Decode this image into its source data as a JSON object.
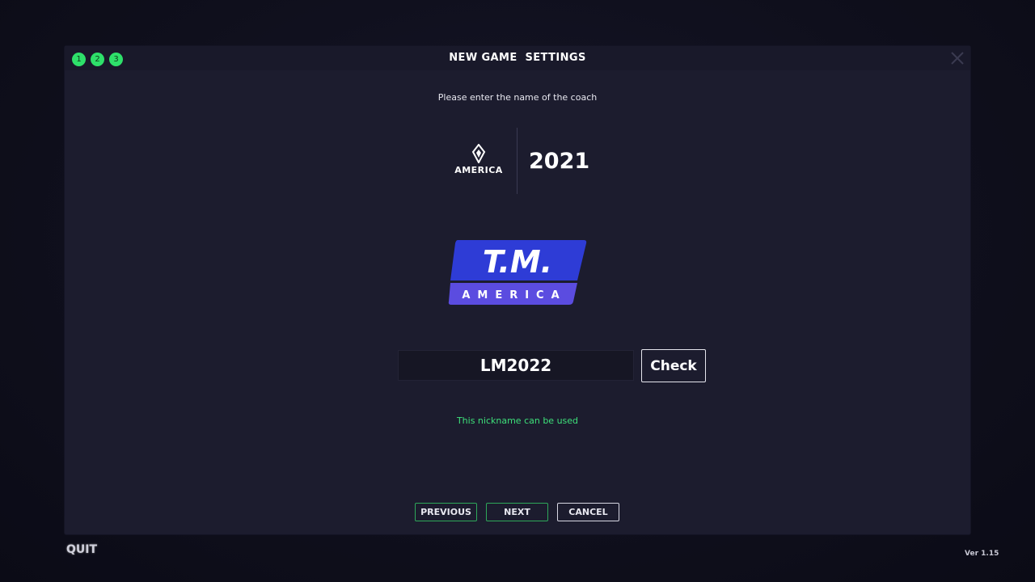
{
  "dialog": {
    "title": "NEW GAME  SETTINGS",
    "steps": [
      "1",
      "2",
      "3"
    ],
    "prompt": "Please enter the name of the coach"
  },
  "league": {
    "name": "AMERICA",
    "season": "2021"
  },
  "team_logo": {
    "line1": "T.M.",
    "line2": "AMERICA",
    "colors": {
      "top": "#2e3cd6",
      "bottom": "#5b4ce0"
    }
  },
  "nickname": {
    "value": "LM2022",
    "check_label": "Check",
    "status": "This nickname can be used",
    "status_color": "#3ee07a"
  },
  "footer": {
    "previous_label": "PREVIOUS",
    "next_label": "NEXT",
    "cancel_label": "CANCEL"
  },
  "quit_label": "QUIT",
  "version": "Ver 1.15",
  "colors": {
    "background": "#0f0f1c",
    "panel": "#1c1c2e",
    "accent_green": "#2ee06a"
  },
  "icons": [
    "close-icon",
    "league-emblem-icon"
  ]
}
